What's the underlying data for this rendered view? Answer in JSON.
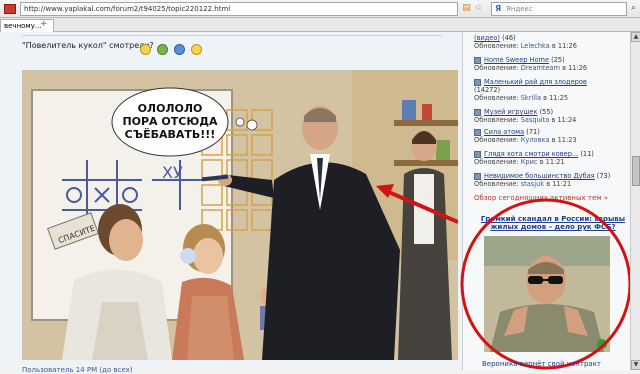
{
  "browser": {
    "url": "http://www.yaplakal.com/forum2/t94025/topic220122.html",
    "search_placeholder": "Яндекс",
    "tab_label": "вечному..."
  },
  "post": {
    "title": "\"Повелитель кукол\" смотрели?",
    "speech_line1": "ОЛОЛОЛО",
    "speech_line2": "ПОРА ОТСЮДА",
    "speech_line3": "СЪЁБАВАТЬ!!!",
    "board_text": "ХУ",
    "sign_text": "СПАСИТЕ",
    "bottom_text": "Пользователь 14 PM (до всех)"
  },
  "sidebar": {
    "items": [
      {
        "label": "(видео)",
        "count": "(46)",
        "updated_label": "Обновление:",
        "updated_user": "Lelechka",
        "updated_time": "в 11:26"
      },
      {
        "label": "Home Sweep Home",
        "count": "(25)",
        "updated_label": "Обновление:",
        "updated_user": "Dreamteam",
        "updated_time": "в 11:26"
      },
      {
        "label": "Маленький рай для злодеров",
        "count": "(14272)",
        "updated_label": "Обновление:",
        "updated_user": "Skrilla",
        "updated_time": "в 11:25"
      },
      {
        "label": "Музей игрушек",
        "count": "(55)",
        "updated_label": "Обновление:",
        "updated_user": "Sasquita",
        "updated_time": "в 11:24"
      },
      {
        "label": "Сила атома",
        "count": "(71)",
        "updated_label": "Обновление:",
        "updated_user": "Куловка",
        "updated_time": "в 11:23"
      },
      {
        "label": "Глядя хота смотри ковер...",
        "count": "(11)",
        "updated_label": "Обновление:",
        "updated_user": "Крис",
        "updated_time": "в 11:21"
      },
      {
        "label": "Невидимое большинство Дубая",
        "count": "(73)",
        "updated_label": "Обновление:",
        "updated_user": "stasjuk",
        "updated_time": "в 11:21"
      }
    ],
    "all_active": "Обзор сегодняшних активных тем »",
    "headline": "Громкий скандал в России: взрывы жилых домов – дело рук ФСБ?",
    "caption": "Вероника вернёт свой контракт"
  },
  "colors": {
    "link": "#1f3f8f",
    "accent_red": "#d01414",
    "panel_bg": "#eef3f7"
  }
}
